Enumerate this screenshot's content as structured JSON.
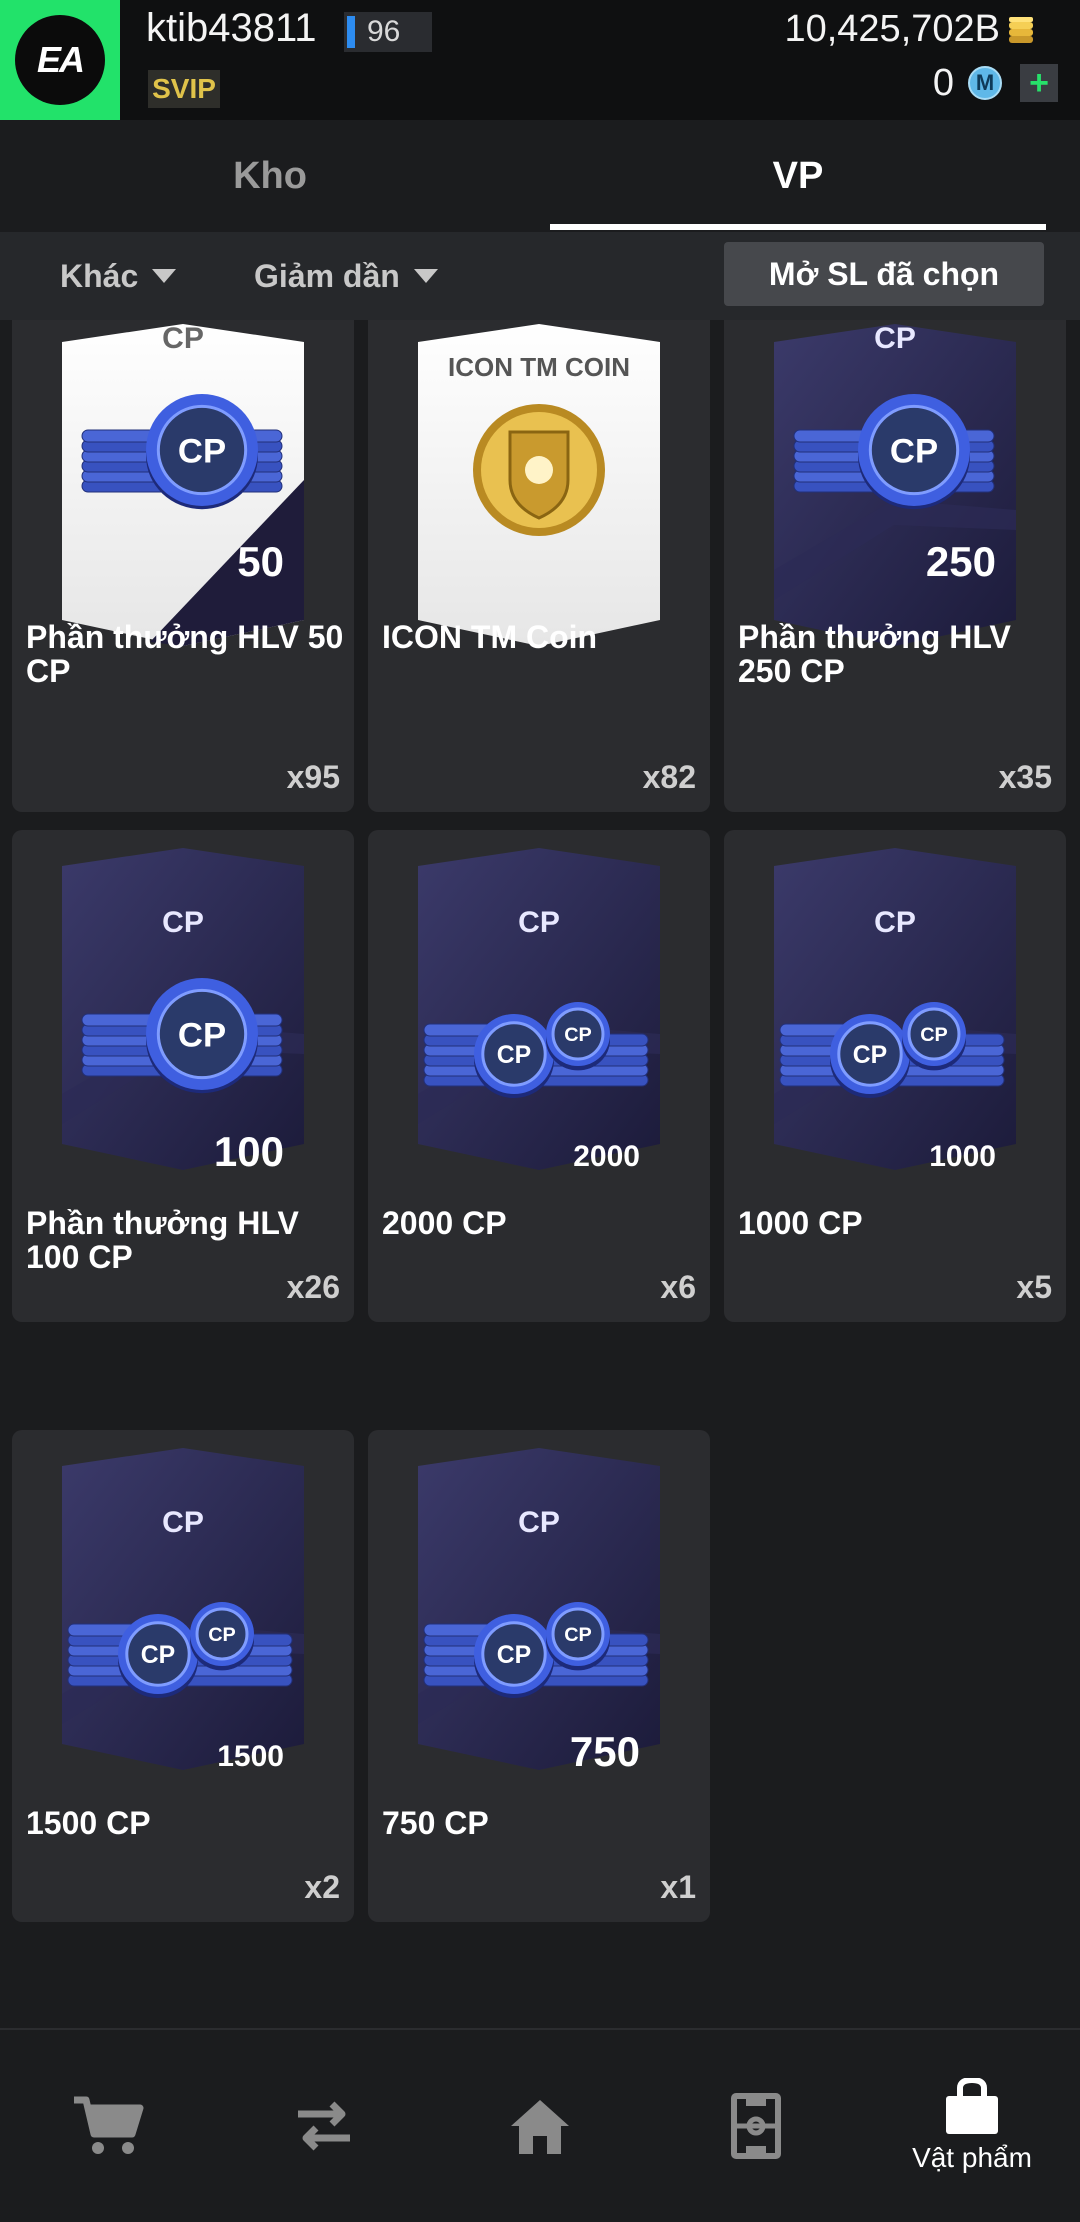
{
  "header": {
    "username": "ktib43811",
    "level": "96",
    "vip": "SVIP",
    "coins": "10,425,702B",
    "mcoins": "0",
    "m_icon_letter": "M"
  },
  "tabs": [
    {
      "label": "Kho",
      "active": false
    },
    {
      "label": "VP",
      "active": true
    }
  ],
  "filters": {
    "type_label": "Khác",
    "sort_label": "Giảm dần",
    "open_button": "Mở SL đã chọn"
  },
  "items": [
    {
      "name": "Phần thưởng HLV 50 CP",
      "qty": "x95",
      "card_title": "CP",
      "card_value": "50",
      "style": "white-cp"
    },
    {
      "name": "ICON TM Coin",
      "qty": "x82",
      "card_title": "ICON TM COIN",
      "card_value": "",
      "style": "icon-coin"
    },
    {
      "name": "Phần thưởng HLV 250 CP",
      "qty": "x35",
      "card_title": "CP",
      "card_value": "250",
      "style": "dark-cp"
    },
    {
      "name": "Phần thưởng HLV 100 CP",
      "qty": "x26",
      "card_title": "CP",
      "card_value": "100",
      "style": "dark-cp"
    },
    {
      "name": "2000 CP",
      "qty": "x6",
      "card_title": "CP",
      "card_value": "2000",
      "style": "dark-cp-multi"
    },
    {
      "name": "1000 CP",
      "qty": "x5",
      "card_title": "CP",
      "card_value": "1000",
      "style": "dark-cp-multi"
    },
    {
      "name": "1500 CP",
      "qty": "x2",
      "card_title": "CP",
      "card_value": "1500",
      "style": "dark-cp-multi"
    },
    {
      "name": "750 CP",
      "qty": "x1",
      "card_title": "CP",
      "card_value": "750",
      "style": "dark-cp-multi"
    }
  ],
  "coin_label": "CP",
  "bottom_nav": [
    {
      "icon": "cart-icon",
      "label": "",
      "active": false
    },
    {
      "icon": "transfer-icon",
      "label": "",
      "active": false
    },
    {
      "icon": "home-icon",
      "label": "",
      "active": false
    },
    {
      "icon": "pitch-icon",
      "label": "",
      "active": false
    },
    {
      "icon": "bag-icon",
      "label": "Vật phẩm",
      "active": true
    }
  ],
  "colors": {
    "brand_green": "#22e26a",
    "background": "#1b1c1e",
    "card": "#2b2c2f",
    "level_blue": "#2d8cf0",
    "svip_gold": "#e0c34a"
  }
}
